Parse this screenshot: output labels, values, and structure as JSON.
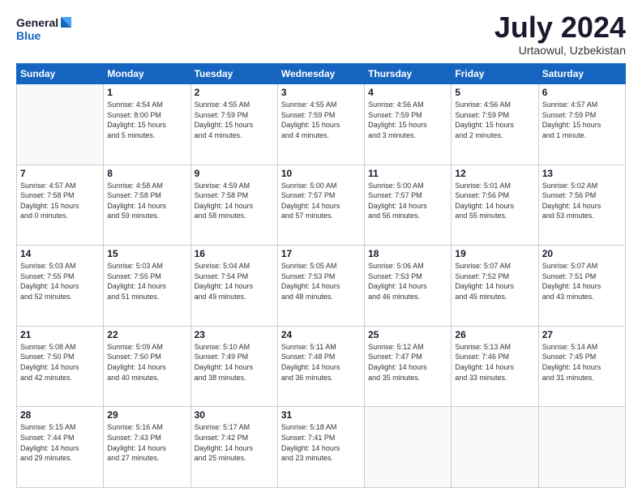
{
  "header": {
    "logo_line1": "General",
    "logo_line2": "Blue",
    "month_title": "July 2024",
    "location": "Urtaowul, Uzbekistan"
  },
  "weekdays": [
    "Sunday",
    "Monday",
    "Tuesday",
    "Wednesday",
    "Thursday",
    "Friday",
    "Saturday"
  ],
  "weeks": [
    [
      {
        "day": "",
        "info": ""
      },
      {
        "day": "1",
        "info": "Sunrise: 4:54 AM\nSunset: 8:00 PM\nDaylight: 15 hours\nand 5 minutes."
      },
      {
        "day": "2",
        "info": "Sunrise: 4:55 AM\nSunset: 7:59 PM\nDaylight: 15 hours\nand 4 minutes."
      },
      {
        "day": "3",
        "info": "Sunrise: 4:55 AM\nSunset: 7:59 PM\nDaylight: 15 hours\nand 4 minutes."
      },
      {
        "day": "4",
        "info": "Sunrise: 4:56 AM\nSunset: 7:59 PM\nDaylight: 15 hours\nand 3 minutes."
      },
      {
        "day": "5",
        "info": "Sunrise: 4:56 AM\nSunset: 7:59 PM\nDaylight: 15 hours\nand 2 minutes."
      },
      {
        "day": "6",
        "info": "Sunrise: 4:57 AM\nSunset: 7:59 PM\nDaylight: 15 hours\nand 1 minute."
      }
    ],
    [
      {
        "day": "7",
        "info": "Sunrise: 4:57 AM\nSunset: 7:58 PM\nDaylight: 15 hours\nand 0 minutes."
      },
      {
        "day": "8",
        "info": "Sunrise: 4:58 AM\nSunset: 7:58 PM\nDaylight: 14 hours\nand 59 minutes."
      },
      {
        "day": "9",
        "info": "Sunrise: 4:59 AM\nSunset: 7:58 PM\nDaylight: 14 hours\nand 58 minutes."
      },
      {
        "day": "10",
        "info": "Sunrise: 5:00 AM\nSunset: 7:57 PM\nDaylight: 14 hours\nand 57 minutes."
      },
      {
        "day": "11",
        "info": "Sunrise: 5:00 AM\nSunset: 7:57 PM\nDaylight: 14 hours\nand 56 minutes."
      },
      {
        "day": "12",
        "info": "Sunrise: 5:01 AM\nSunset: 7:56 PM\nDaylight: 14 hours\nand 55 minutes."
      },
      {
        "day": "13",
        "info": "Sunrise: 5:02 AM\nSunset: 7:56 PM\nDaylight: 14 hours\nand 53 minutes."
      }
    ],
    [
      {
        "day": "14",
        "info": "Sunrise: 5:03 AM\nSunset: 7:55 PM\nDaylight: 14 hours\nand 52 minutes."
      },
      {
        "day": "15",
        "info": "Sunrise: 5:03 AM\nSunset: 7:55 PM\nDaylight: 14 hours\nand 51 minutes."
      },
      {
        "day": "16",
        "info": "Sunrise: 5:04 AM\nSunset: 7:54 PM\nDaylight: 14 hours\nand 49 minutes."
      },
      {
        "day": "17",
        "info": "Sunrise: 5:05 AM\nSunset: 7:53 PM\nDaylight: 14 hours\nand 48 minutes."
      },
      {
        "day": "18",
        "info": "Sunrise: 5:06 AM\nSunset: 7:53 PM\nDaylight: 14 hours\nand 46 minutes."
      },
      {
        "day": "19",
        "info": "Sunrise: 5:07 AM\nSunset: 7:52 PM\nDaylight: 14 hours\nand 45 minutes."
      },
      {
        "day": "20",
        "info": "Sunrise: 5:07 AM\nSunset: 7:51 PM\nDaylight: 14 hours\nand 43 minutes."
      }
    ],
    [
      {
        "day": "21",
        "info": "Sunrise: 5:08 AM\nSunset: 7:50 PM\nDaylight: 14 hours\nand 42 minutes."
      },
      {
        "day": "22",
        "info": "Sunrise: 5:09 AM\nSunset: 7:50 PM\nDaylight: 14 hours\nand 40 minutes."
      },
      {
        "day": "23",
        "info": "Sunrise: 5:10 AM\nSunset: 7:49 PM\nDaylight: 14 hours\nand 38 minutes."
      },
      {
        "day": "24",
        "info": "Sunrise: 5:11 AM\nSunset: 7:48 PM\nDaylight: 14 hours\nand 36 minutes."
      },
      {
        "day": "25",
        "info": "Sunrise: 5:12 AM\nSunset: 7:47 PM\nDaylight: 14 hours\nand 35 minutes."
      },
      {
        "day": "26",
        "info": "Sunrise: 5:13 AM\nSunset: 7:46 PM\nDaylight: 14 hours\nand 33 minutes."
      },
      {
        "day": "27",
        "info": "Sunrise: 5:14 AM\nSunset: 7:45 PM\nDaylight: 14 hours\nand 31 minutes."
      }
    ],
    [
      {
        "day": "28",
        "info": "Sunrise: 5:15 AM\nSunset: 7:44 PM\nDaylight: 14 hours\nand 29 minutes."
      },
      {
        "day": "29",
        "info": "Sunrise: 5:16 AM\nSunset: 7:43 PM\nDaylight: 14 hours\nand 27 minutes."
      },
      {
        "day": "30",
        "info": "Sunrise: 5:17 AM\nSunset: 7:42 PM\nDaylight: 14 hours\nand 25 minutes."
      },
      {
        "day": "31",
        "info": "Sunrise: 5:18 AM\nSunset: 7:41 PM\nDaylight: 14 hours\nand 23 minutes."
      },
      {
        "day": "",
        "info": ""
      },
      {
        "day": "",
        "info": ""
      },
      {
        "day": "",
        "info": ""
      }
    ]
  ]
}
